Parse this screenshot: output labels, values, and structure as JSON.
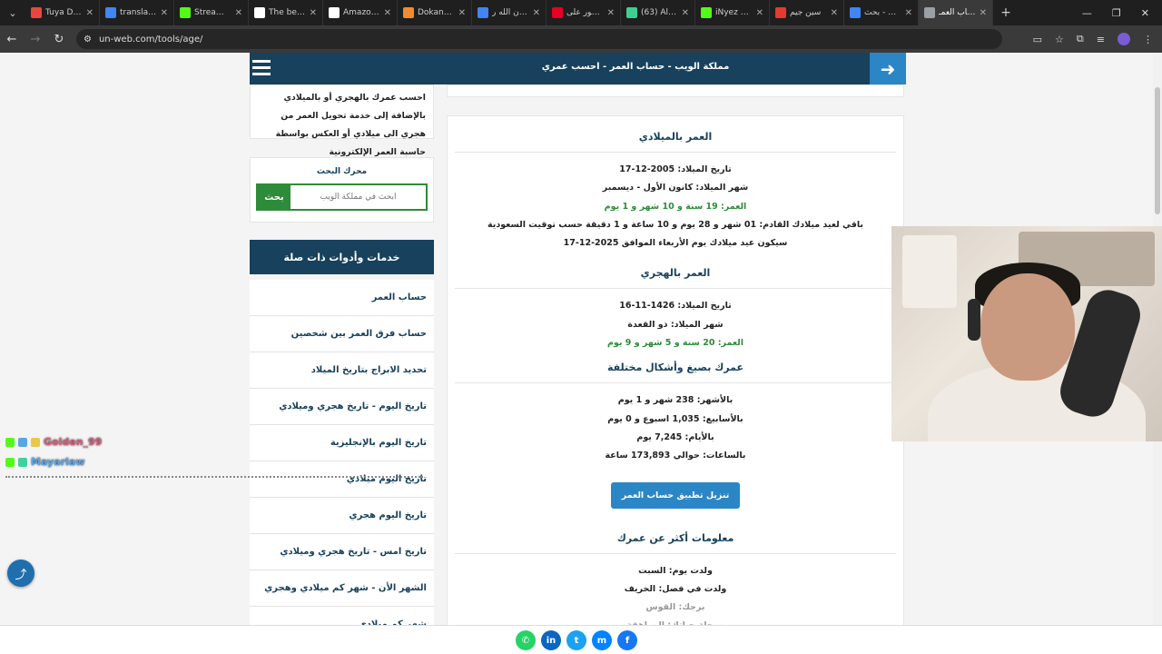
{
  "tabs": [
    {
      "title": "Tuya Deve",
      "color": "#e8473c"
    },
    {
      "title": "translate -",
      "color": "#4285f4"
    },
    {
      "title": "Stream - K",
      "color": "#53fc18"
    },
    {
      "title": "The best C",
      "color": "#ffffff"
    },
    {
      "title": "Amazon.sa",
      "color": "#ffffff"
    },
    {
      "title": "DokanTIP",
      "color": "#f28b30"
    },
    {
      "title": "فمان الله ر",
      "color": "#4285f4"
    },
    {
      "title": "منشور علی",
      "color": "#e60023"
    },
    {
      "title": "(63) Alert",
      "color": "#3ecf8e"
    },
    {
      "title": "iNyez Stre",
      "color": "#53fc18"
    },
    {
      "title": "سين جيم",
      "color": "#e33b2e"
    },
    {
      "title": "تعلم - بحث",
      "color": "#4285f4"
    },
    {
      "title": "حساب العمـ",
      "color": "#9aa0a6"
    }
  ],
  "browser": {
    "url": "un-web.com/tools/age/"
  },
  "site": {
    "title": "مملكة الويب - حساب العمر - احسب عمري"
  },
  "intro": "احسب عمرك بالهجري أو بالميلادي بالإضافة إلى خدمة تحويل العمر من هجري الى ميلادي أو العكس بواسطة حاسبة العمر الإلكترونية",
  "search": {
    "title": "محرك البحث",
    "placeholder": "ابحث في مملكة الويب",
    "button": "بحث"
  },
  "services": {
    "title": "خدمات وأدوات ذات صلة",
    "items": [
      "حساب العمر",
      "حساب فرق العمر بين شخصين",
      "تحديد الابراج بتاريخ الميلاد",
      "تاريخ اليوم - تاريخ هجري وميلادي",
      "تاريخ اليوم بالإنجليزية",
      "تاريخ اليوم ميلادي",
      "تاريخ اليوم هجري",
      "تاريخ امس - تاريخ هجري وميلادي",
      "الشهر الأن - شهر كم ميلادي وهجري",
      "شهر كم ميلادي"
    ]
  },
  "gregorian": {
    "title": "العمر بالميلادي",
    "birth": "تاريخ الميلاد: 2005-12-17",
    "month": "شهر الميلاد: كانون الأول - ديسمبر",
    "age": "العمر: 19 سنة و 10 شهر و 1 يوم",
    "remaining": "باقي لعيد ميلادك القادم: 01 شهر و 28 يوم و 10 ساعة و 1 دقيقة حسب توقيت السعودية",
    "next": "سيكون عيد ميلادك يوم الأربعاء الموافق 2025-12-17"
  },
  "hijri": {
    "title": "العمر بالهجري",
    "birth": "تاريخ الميلاد: 1426-11-16",
    "month": "شهر الميلاد: ذو القعدة",
    "age": "العمر: 20 سنة و 5 شهر و 9 يوم"
  },
  "formats": {
    "title": "عمرك بصيغ وأشكال مختلفة",
    "months": "بالأشهر: 238 شهر و 1 يوم",
    "weeks": "بالأسابيع: 1,035 اسبوع و 0 يوم",
    "days": "بالأيام: 7,245 يوم",
    "hours": "بالساعات: حوالي 173,893 ساعة"
  },
  "download": "تنزيل تطبيق حساب العمر",
  "more": {
    "title": "معلومات أكثر عن عمرك",
    "day": "ولدت يوم: السبت",
    "season": "ولدت في فصل: الخريف",
    "zodiac": "برجك: القوس",
    "stage": "مرحلة حياتك: المراهقة"
  },
  "chat": [
    {
      "user": "Golden_99",
      "color": "#d4607a"
    },
    {
      "user": "Mayarlaw",
      "color": "#58a6e8"
    }
  ],
  "social": [
    {
      "name": "whatsapp",
      "color": "#25d366",
      "glyph": "✆"
    },
    {
      "name": "linkedin",
      "color": "#0a66c2",
      "glyph": "in"
    },
    {
      "name": "twitter",
      "color": "#1da1f2",
      "glyph": "t"
    },
    {
      "name": "messenger",
      "color": "#0084ff",
      "glyph": "m"
    },
    {
      "name": "facebook",
      "color": "#1877f2",
      "glyph": "f"
    }
  ]
}
